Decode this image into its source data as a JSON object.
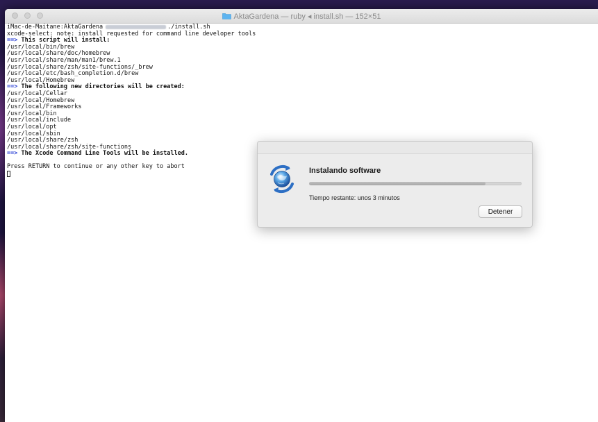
{
  "window": {
    "title": "AktaGardena — ruby ◂ install.sh — 152×51"
  },
  "terminal": {
    "prompt": "iMac-de-Maitane:AktaGardena",
    "command": "./install.sh",
    "lines": [
      {
        "text": "xcode-select: note: install requested for command line developer tools",
        "style": "normal"
      },
      {
        "text": "This script will install:",
        "style": "heading"
      },
      {
        "text": "/usr/local/bin/brew",
        "style": "normal"
      },
      {
        "text": "/usr/local/share/doc/homebrew",
        "style": "normal"
      },
      {
        "text": "/usr/local/share/man/man1/brew.1",
        "style": "normal"
      },
      {
        "text": "/usr/local/share/zsh/site-functions/_brew",
        "style": "normal"
      },
      {
        "text": "/usr/local/etc/bash_completion.d/brew",
        "style": "normal"
      },
      {
        "text": "/usr/local/Homebrew",
        "style": "normal"
      },
      {
        "text": "The following new directories will be created:",
        "style": "heading"
      },
      {
        "text": "/usr/local/Cellar",
        "style": "normal"
      },
      {
        "text": "/usr/local/Homebrew",
        "style": "normal"
      },
      {
        "text": "/usr/local/Frameworks",
        "style": "normal"
      },
      {
        "text": "/usr/local/bin",
        "style": "normal"
      },
      {
        "text": "/usr/local/include",
        "style": "normal"
      },
      {
        "text": "/usr/local/opt",
        "style": "normal"
      },
      {
        "text": "/usr/local/sbin",
        "style": "normal"
      },
      {
        "text": "/usr/local/share/zsh",
        "style": "normal"
      },
      {
        "text": "/usr/local/share/zsh/site-functions",
        "style": "normal"
      },
      {
        "text": "The Xcode Command Line Tools will be installed.",
        "style": "heading"
      },
      {
        "text": "",
        "style": "normal"
      },
      {
        "text": "Press RETURN to continue or any other key to abort",
        "style": "normal"
      }
    ],
    "heading_marker": "==>"
  },
  "dialog": {
    "heading": "Instalando software",
    "status": "Tiempo restante: unos 3 minutos",
    "progress_fraction": 0.83,
    "stop_label": "Detener",
    "icon": "installer-globe-icon"
  },
  "colors": {
    "heading_marker": "#2a3fd4",
    "terminal_background": "#ffffff",
    "dialog_background": "#ececec"
  }
}
